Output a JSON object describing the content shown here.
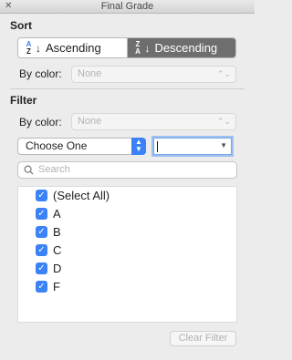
{
  "window": {
    "title": "Final Grade",
    "close_glyph": "✕"
  },
  "sort": {
    "heading": "Sort",
    "ascending_label": "Ascending",
    "descending_label": "Descending",
    "selected": "Descending",
    "by_color_label": "By color:",
    "by_color_value": "None"
  },
  "filter": {
    "heading": "Filter",
    "by_color_label": "By color:",
    "by_color_value": "None",
    "condition_value": "Choose One",
    "condition_text": "",
    "search_placeholder": "Search",
    "items": [
      {
        "label": "(Select All)",
        "checked": true
      },
      {
        "label": "A",
        "checked": true
      },
      {
        "label": "B",
        "checked": true
      },
      {
        "label": "C",
        "checked": true
      },
      {
        "label": "D",
        "checked": true
      },
      {
        "label": "F",
        "checked": true
      }
    ],
    "clear_label": "Clear Filter"
  },
  "colors": {
    "accent": "#3b82f6",
    "selected_segment": "#6e6e6e"
  }
}
